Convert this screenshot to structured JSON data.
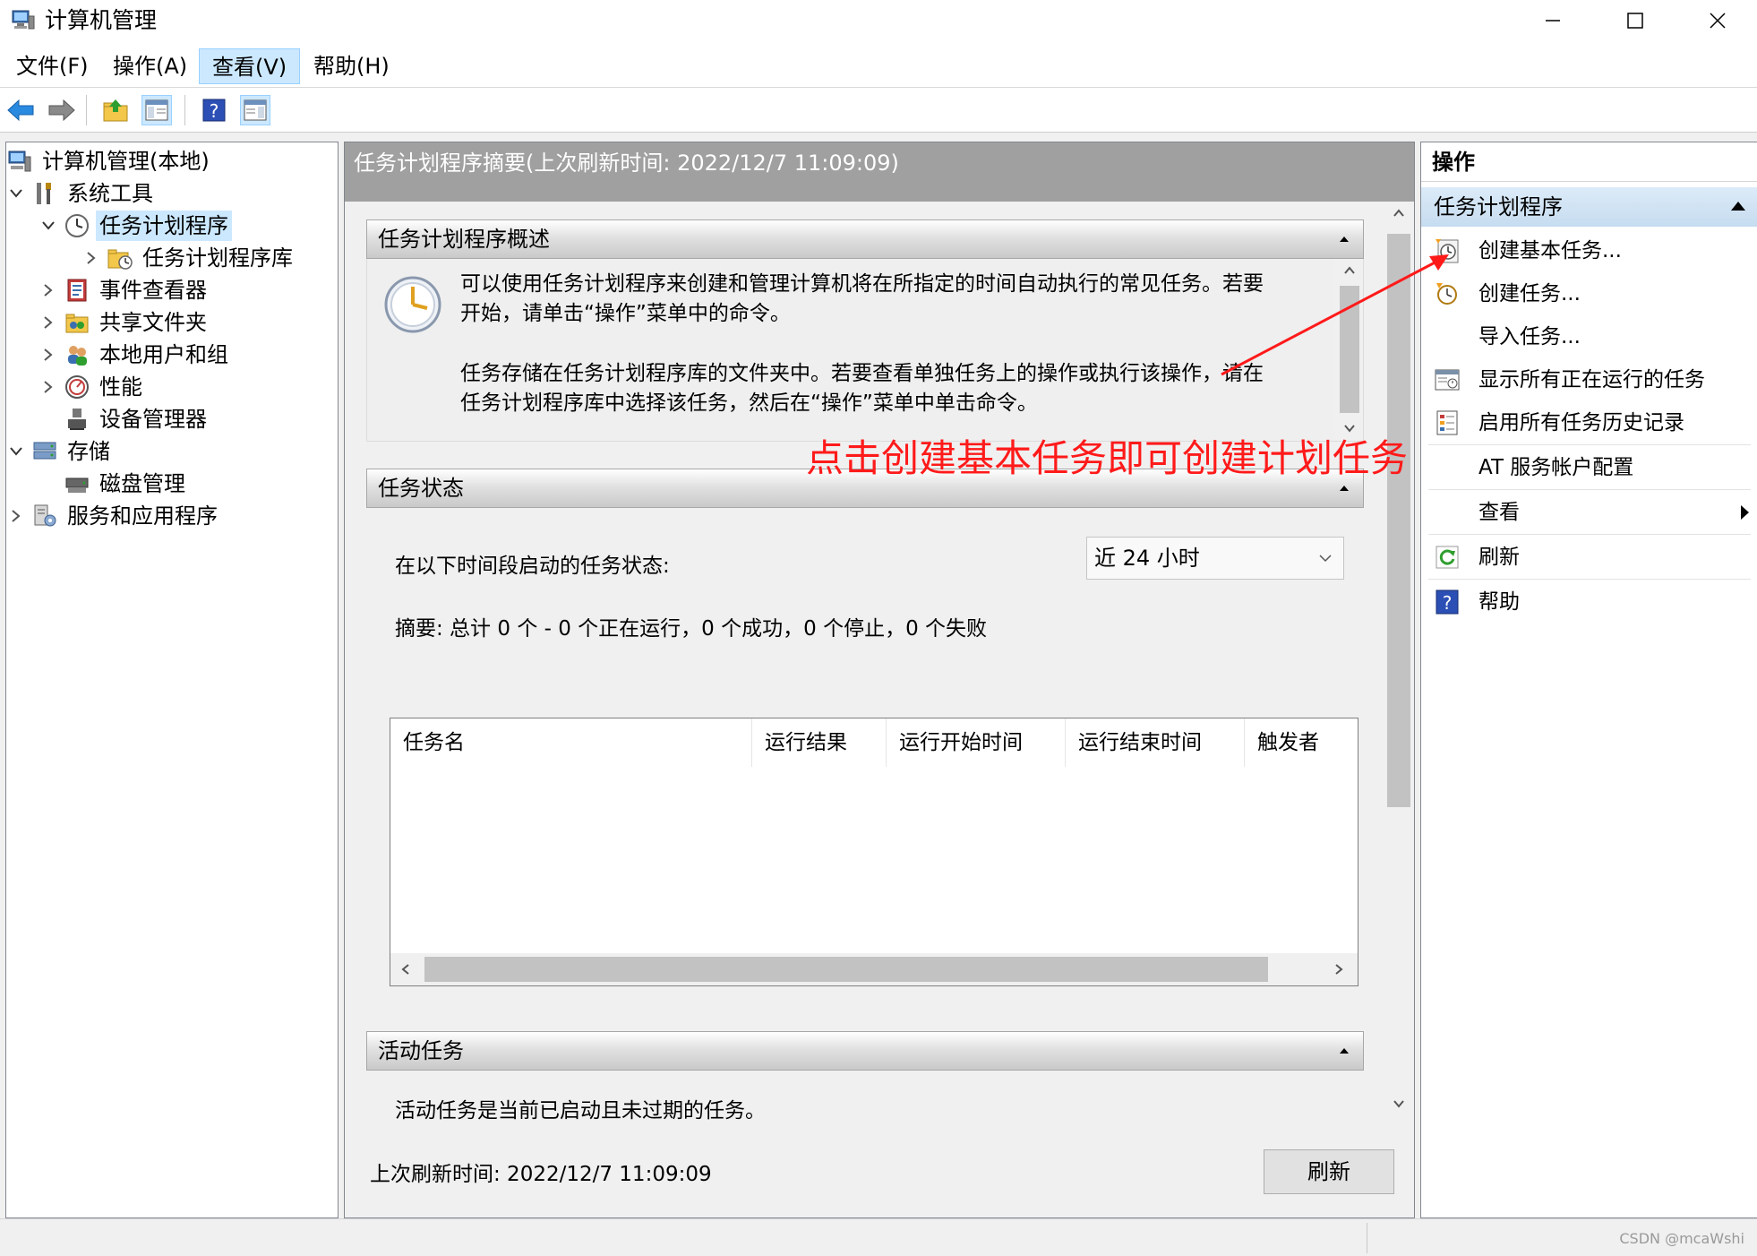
{
  "window": {
    "title": "计算机管理",
    "controls": [
      "minimize",
      "maximize",
      "close"
    ]
  },
  "menu": [
    {
      "label": "文件(F)"
    },
    {
      "label": "操作(A)"
    },
    {
      "label": "查看(V)",
      "active": true
    },
    {
      "label": "帮助(H)"
    }
  ],
  "toolbar": {
    "icons": [
      "back-arrow-icon",
      "forward-arrow-icon",
      "up-folder-icon",
      "show-hide-tree-icon",
      "help-icon",
      "show-hide-action-pane-icon"
    ]
  },
  "tree": {
    "root": "计算机管理(本地)",
    "system_tools": "系统工具",
    "task_scheduler": "任务计划程序",
    "task_scheduler_library": "任务计划程序库",
    "event_viewer": "事件查看器",
    "shared_folders": "共享文件夹",
    "local_users": "本地用户和组",
    "performance": "性能",
    "device_manager": "设备管理器",
    "storage": "存储",
    "disk_management": "磁盘管理",
    "services_apps": "服务和应用程序"
  },
  "center": {
    "header": "任务计划程序摘要(上次刷新时间: 2022/12/7 11:09:09)",
    "overview": {
      "title": "任务计划程序概述",
      "para1_line1": "可以使用任务计划程序来创建和管理计算机将在所指定的时间自动执行的常见任务。若要",
      "para1_line2": "开始，请单击“操作”菜单中的命令。",
      "para2_line1": "任务存储在任务计划程序库的文件夹中。若要查看单独任务上的操作或执行该操作，请在",
      "para2_line2": "任务计划程序库中选择该任务，然后在“操作”菜单中单击命令。"
    },
    "task_status": {
      "title": "任务状态",
      "label": "在以下时间段启动的任务状态:",
      "period": "近 24 小时",
      "summary": "摘要: 总计 0 个 - 0 个正在运行，0 个成功，0 个停止，0 个失败",
      "columns": [
        "任务名",
        "运行结果",
        "运行开始时间",
        "运行结束时间",
        "触发者"
      ]
    },
    "active_tasks": {
      "title": "活动任务",
      "partial_text": "活动任务是当前已启动且未过期的任务。"
    },
    "footer_label": "上次刷新时间: 2022/12/7 11:09:09",
    "refresh_button": "刷新"
  },
  "actions": {
    "title": "操作",
    "section": "任务计划程序",
    "items": [
      {
        "label": "创建基本任务...",
        "icon": "create-basic-task-icon"
      },
      {
        "label": "创建任务...",
        "icon": "create-task-icon"
      },
      {
        "label": "导入任务...",
        "icon": ""
      },
      {
        "label": "显示所有正在运行的任务",
        "icon": "running-tasks-icon"
      },
      {
        "label": "启用所有任务历史记录",
        "icon": "task-history-icon"
      },
      {
        "label": "AT 服务帐户配置",
        "icon": ""
      },
      {
        "label": "查看",
        "icon": "",
        "submenu": true
      },
      {
        "label": "刷新",
        "icon": "refresh-icon"
      },
      {
        "label": "帮助",
        "icon": "help-icon"
      }
    ]
  },
  "annotation": {
    "text": "点击创建基本任务即可创建计划任务",
    "color": "#ff1a1a"
  },
  "statusbar": {
    "watermark": "CSDN @mcaWshi"
  },
  "colors": {
    "selection": "#cce8ff",
    "header_gray": "#a0a0a0",
    "action_header": "#c6dcf0"
  }
}
